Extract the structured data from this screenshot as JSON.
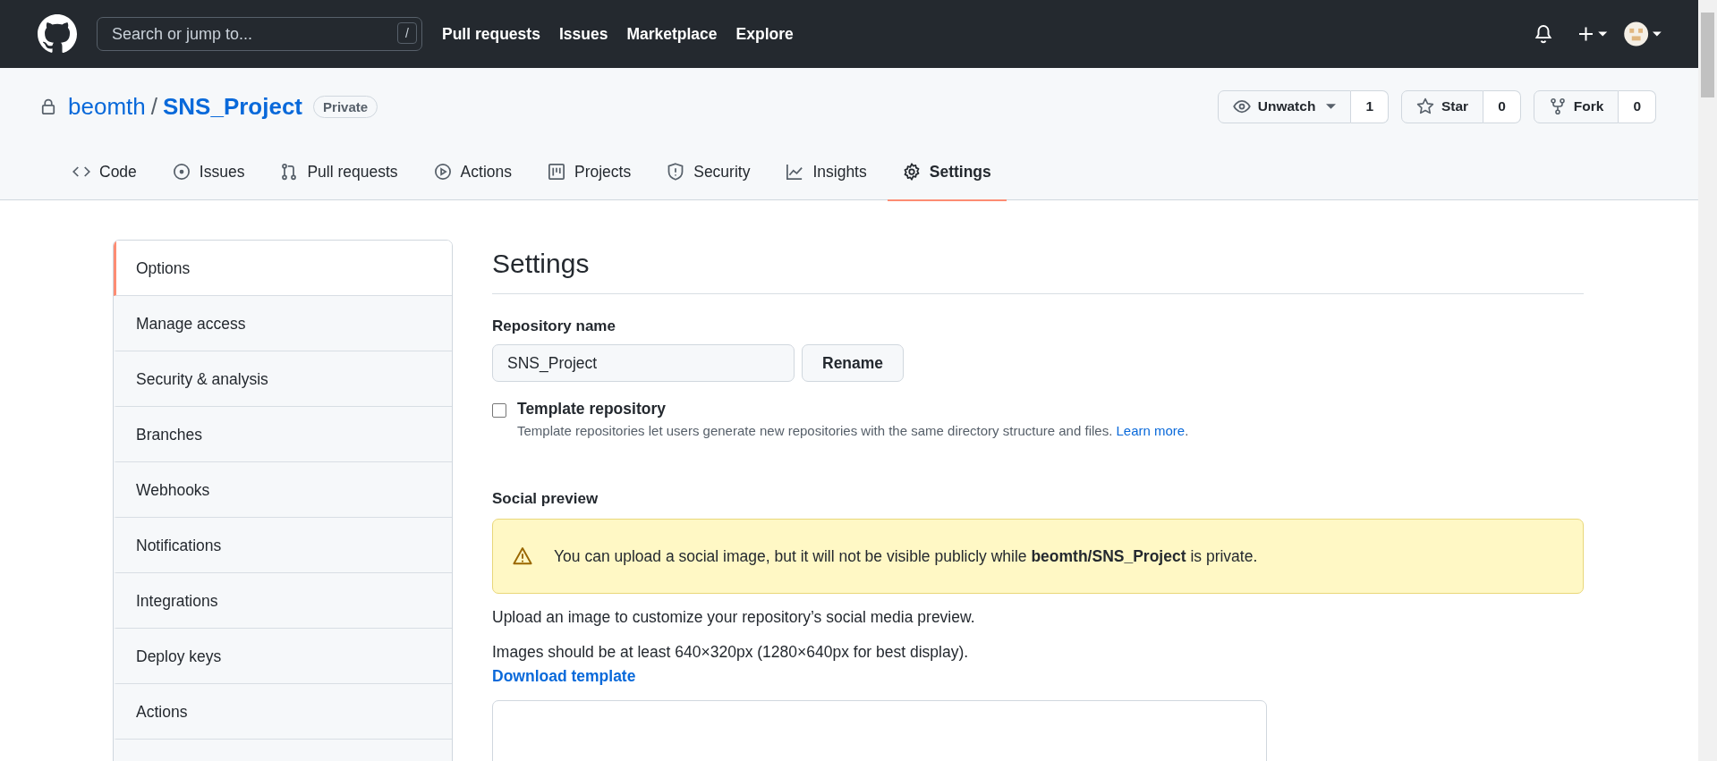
{
  "header": {
    "search_placeholder": "Search or jump to...",
    "search_key": "/",
    "nav": [
      "Pull requests",
      "Issues",
      "Marketplace",
      "Explore"
    ]
  },
  "repo": {
    "owner": "beomth",
    "separator": "/",
    "name": "SNS_Project",
    "visibility": "Private",
    "actions": [
      {
        "kind": "watch",
        "label": "Unwatch",
        "count": "1"
      },
      {
        "kind": "star",
        "label": "Star",
        "count": "0"
      },
      {
        "kind": "fork",
        "label": "Fork",
        "count": "0"
      }
    ]
  },
  "tabs": [
    {
      "kind": "code",
      "label": "Code",
      "selected": false
    },
    {
      "kind": "issues",
      "label": "Issues",
      "selected": false
    },
    {
      "kind": "pulls",
      "label": "Pull requests",
      "selected": false
    },
    {
      "kind": "actions",
      "label": "Actions",
      "selected": false
    },
    {
      "kind": "projects",
      "label": "Projects",
      "selected": false
    },
    {
      "kind": "security",
      "label": "Security",
      "selected": false
    },
    {
      "kind": "insights",
      "label": "Insights",
      "selected": false
    },
    {
      "kind": "settings",
      "label": "Settings",
      "selected": true
    }
  ],
  "sidebar": {
    "items": [
      {
        "label": "Options",
        "selected": true
      },
      {
        "label": "Manage access",
        "selected": false
      },
      {
        "label": "Security & analysis",
        "selected": false
      },
      {
        "label": "Branches",
        "selected": false
      },
      {
        "label": "Webhooks",
        "selected": false
      },
      {
        "label": "Notifications",
        "selected": false
      },
      {
        "label": "Integrations",
        "selected": false
      },
      {
        "label": "Deploy keys",
        "selected": false
      },
      {
        "label": "Actions",
        "selected": false
      }
    ]
  },
  "settings": {
    "title": "Settings",
    "repo_name_label": "Repository name",
    "repo_name_value": "SNS_Project",
    "rename_button": "Rename",
    "template": {
      "label": "Template repository",
      "checked": false,
      "note": "Template repositories let users generate new repositories with the same directory structure and files.",
      "link": "Learn more",
      "after_link": "."
    },
    "social": {
      "title": "Social preview",
      "warning": "You can upload a social image, but it will not be visible publicly while **beomth/SNS_Project** is private.",
      "text_1": "Upload an image to customize your repository’s social media preview.",
      "text_2": "Images should be at least 640×320px (1280×640px for best display).",
      "download_link": "Download template"
    }
  }
}
